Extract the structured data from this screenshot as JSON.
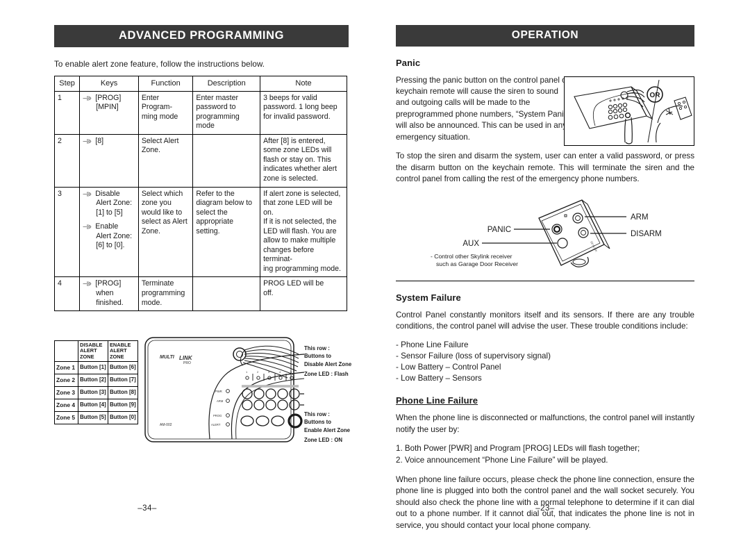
{
  "left": {
    "banner": "ADVANCED PROGRAMMING",
    "intro": "To enable alert zone feature, follow the instructions below.",
    "page_number": "–34–",
    "steps_table": {
      "headers": [
        "Step",
        "Keys",
        "Function",
        "Description",
        "Note"
      ],
      "rows": [
        {
          "step": "1",
          "keys_main": "[PROG]",
          "keys_sub": "[MPIN]",
          "keys2_main": "",
          "keys2_sub": "",
          "function": "Enter Program-\nming mode",
          "description": "Enter master\npassword to\nprogramming mode",
          "note": "3 beeps for valid\npassword. 1 long beep\nfor invalid password."
        },
        {
          "step": "2",
          "keys_main": "[8]",
          "keys_sub": "",
          "keys2_main": "",
          "keys2_sub": "",
          "function": "Select Alert\nZone.",
          "description": "",
          "note": "After [8] is entered,\nsome zone LEDs will\nflash or stay on.  This\nindicates whether alert\nzone is selected."
        },
        {
          "step": "3",
          "keys_main": "Disable",
          "keys_sub": "Alert Zone:\n[1] to [5]",
          "keys2_main": "Enable",
          "keys2_sub": "Alert Zone:\n[6] to [0].",
          "function": "Select which\nzone you\nwould like to\nselect as Alert\nZone.",
          "description": "Refer to the\ndiagram below to\nselect the\nappropriate\nsetting.",
          "note": "If alert zone is selected,\nthat zone LED will be on.\nIf it is not selected, the\nLED will flash. You are\nallow to make multiple\nchanges before terminat-\ning programming mode."
        },
        {
          "step": "4",
          "keys_main": "[PROG]",
          "keys_sub": "when\nfinished.",
          "keys2_main": "",
          "keys2_sub": "",
          "function": "Terminate\nprogramming\nmode.",
          "description": "",
          "note": "PROG LED will be\noff."
        }
      ]
    },
    "zone_table": {
      "corner": "",
      "headers": [
        "DISABLE\nALERT ZONE",
        "ENABLE\nALERT ZONE"
      ],
      "rows": [
        {
          "zone": "Zone 1",
          "disable": "Button [1]",
          "enable": "Button [6]"
        },
        {
          "zone": "Zone 2",
          "disable": "Button [2]",
          "enable": "Button [7]"
        },
        {
          "zone": "Zone 3",
          "disable": "Button [3]",
          "enable": "Button [8]"
        },
        {
          "zone": "Zone 4",
          "disable": "Button [4]",
          "enable": "Button [9]"
        },
        {
          "zone": "Zone 5",
          "disable": "Button [5]",
          "enable": "Button [0]"
        }
      ]
    },
    "panel_labels": {
      "brand": "MULTI LINK pro",
      "model": "AM-002",
      "leds": [
        "PWR",
        "ARM",
        "PROG",
        "ALERT"
      ],
      "zone_numbers": [
        "1",
        "2",
        "3",
        "4",
        "5"
      ]
    },
    "callout_top": {
      "l1": "This row      :",
      "l2": "Buttons  to",
      "l3": "Disable Alert Zone",
      "l4": "Zone LED : Flash"
    },
    "callout_bottom": {
      "l1": "This row      :",
      "l2": "Buttons  to",
      "l3": "Enable Alert Zone",
      "l4": "Zone LED : ON"
    }
  },
  "right": {
    "banner": "OPERATION",
    "page_number": "–23–",
    "panic": {
      "heading": "Panic",
      "paragraph1": "Pressing the panic button on the control panel or keychain remote will cause the siren to sound and outgoing calls will be made to the preprogrammed phone numbers, “System Panic” will also be announced.  This can be used in any emergency situation.",
      "paragraph2": "To stop the siren and disarm the system, user can enter a valid password, or press the disarm button on the keychain remote.  This will terminate the siren and the control panel from calling the rest of the emergency phone numbers.",
      "figure_or_label": "OR"
    },
    "remote": {
      "labels": {
        "panic": "PANIC",
        "aux": "AUX",
        "arm": "ARM",
        "disarm": "DISARM"
      },
      "footnote_line1": "- Control other Skylink receiver",
      "footnote_line2": "such as Garage Door Receiver"
    },
    "system_failure": {
      "heading": "System Failure",
      "paragraph": "Control Panel constantly monitors itself and its sensors.  If there are any trouble conditions, the control panel will advise the user.  These trouble conditions include:",
      "conditions": [
        "- Phone Line Failure",
        "- Sensor Failure (loss of supervisory signal)",
        "- Low Battery – Control Panel",
        "- Low Battery – Sensors"
      ]
    },
    "phone_line_failure": {
      "heading": "Phone Line Failure",
      "paragraph1": "When the phone line is disconnected or malfunctions, the control panel will instantly notify the user by:",
      "items": [
        "1. Both Power [PWR] and Program [PROG] LEDs will flash together;",
        "2. Voice announcement “Phone Line Failure” will be played."
      ],
      "paragraph2": "When phone line failure occurs, please check the phone line connection, ensure the phone line is plugged into both the control panel and the wall socket securely. You should also check the phone line with a normal telephone to determine if it can dial out to a phone number.  If it cannot dial out, that indicates the phone line is not in service, you should contact your local phone company."
    }
  },
  "colors": {
    "banner_bg": "#3a3a3a",
    "banner_text": "#ffffff",
    "ink": "#1a1a1a",
    "page_bg": "#ffffff"
  }
}
